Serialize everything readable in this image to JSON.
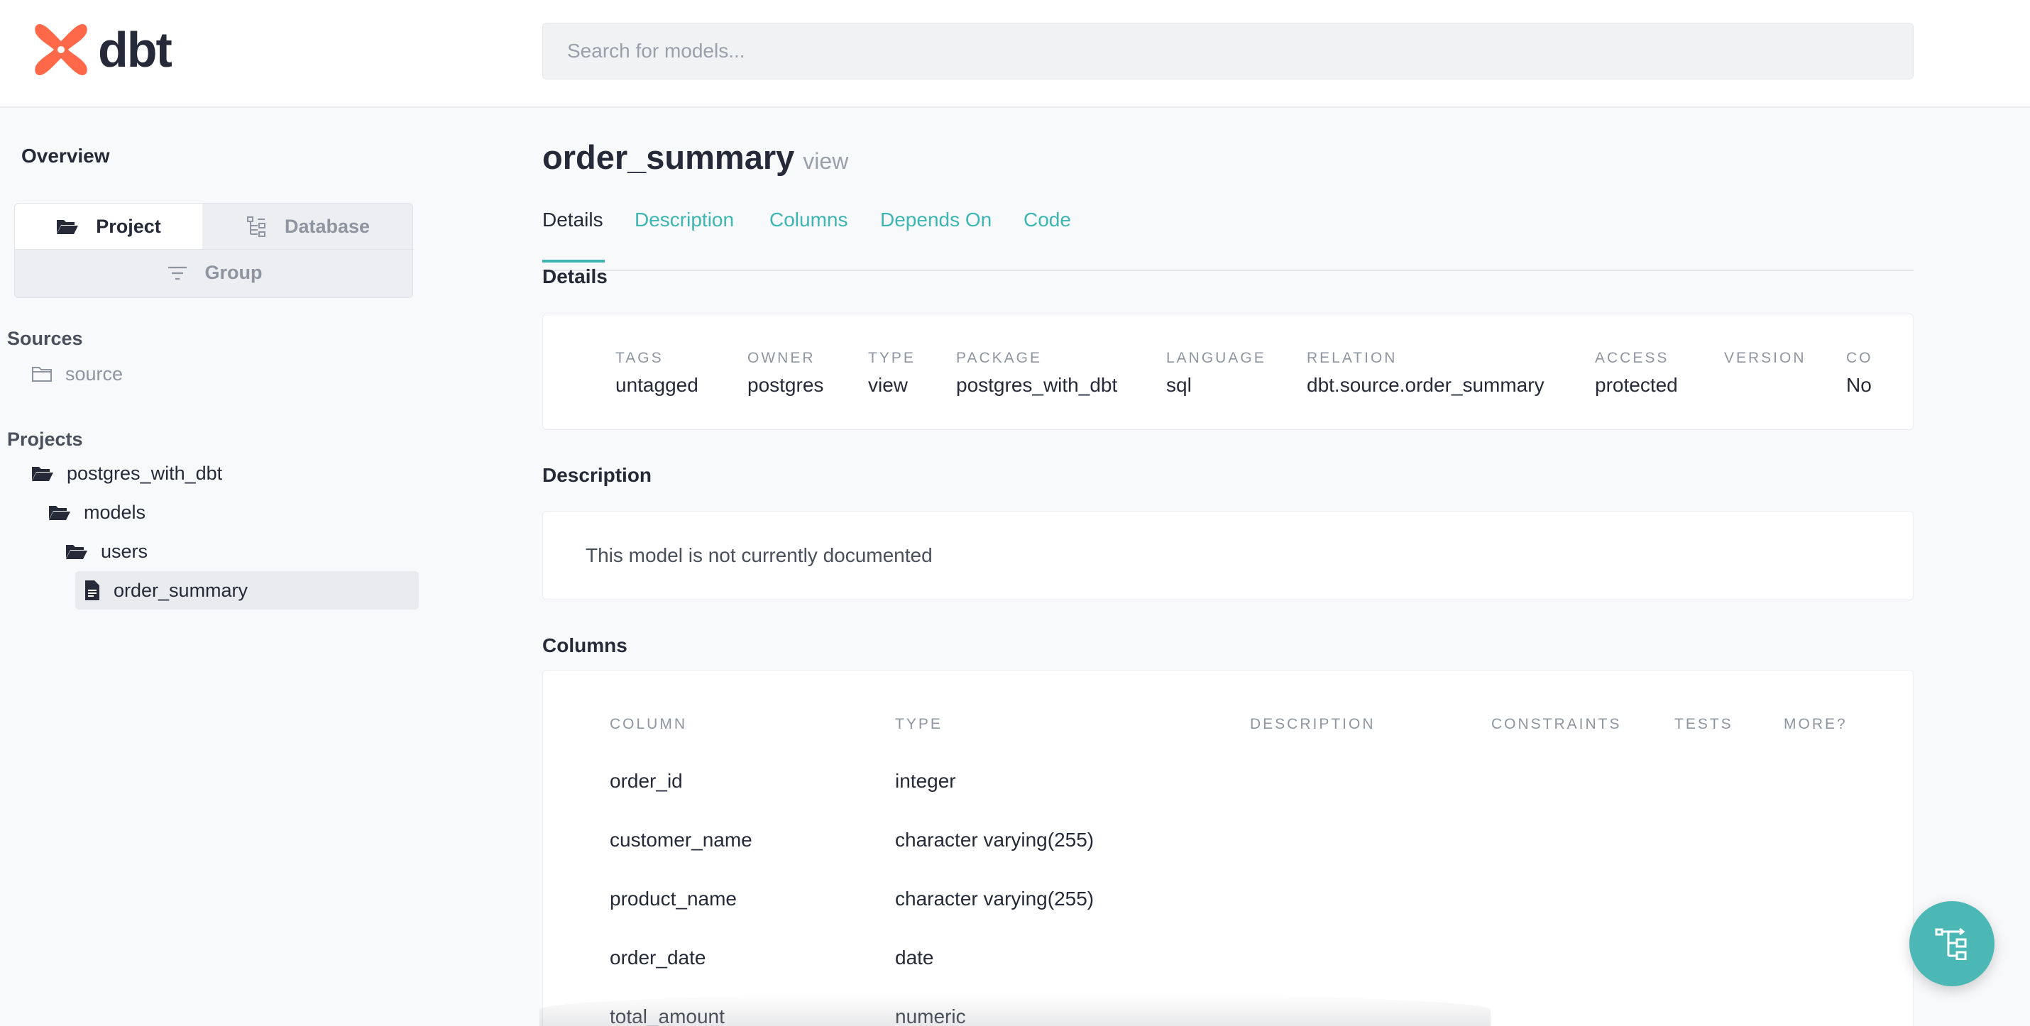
{
  "header": {
    "logo_text": "dbt",
    "search_placeholder": "Search for models...",
    "brand_color": "#ff694a"
  },
  "sidebar": {
    "overview": "Overview",
    "view_tabs": {
      "project": "Project",
      "database": "Database",
      "group": "Group"
    },
    "sources_label": "Sources",
    "sources": [
      {
        "label": "source",
        "icon": "folder-outline-icon"
      }
    ],
    "projects_label": "Projects",
    "tree": [
      {
        "label": "postgres_with_dbt",
        "icon": "folder-open-icon"
      },
      {
        "label": "models",
        "icon": "folder-open-icon"
      },
      {
        "label": "users",
        "icon": "folder-open-icon"
      },
      {
        "label": "order_summary",
        "icon": "file-icon",
        "active": true
      }
    ]
  },
  "main": {
    "title": "order_summary",
    "title_sub": "view",
    "tabs": [
      {
        "label": "Details",
        "active": true
      },
      {
        "label": "Description"
      },
      {
        "label": "Columns"
      },
      {
        "label": "Depends On"
      },
      {
        "label": "Code"
      }
    ],
    "details_heading": "Details",
    "details": {
      "tags_label": "TAGS",
      "tags_value": "untagged",
      "owner_label": "OWNER",
      "owner_value": "postgres",
      "type_label": "TYPE",
      "type_value": "view",
      "package_label": "PACKAGE",
      "package_value": "postgres_with_dbt",
      "language_label": "LANGUAGE",
      "language_value": "sql",
      "relation_label": "RELATION",
      "relation_value": "dbt.source.order_summary",
      "access_label": "ACCESS",
      "access_value": "protected",
      "version_label": "VERSION",
      "version_value": "",
      "contract_label": "CO",
      "contract_value": "No"
    },
    "description_heading": "Description",
    "description_text": "This model is not currently documented",
    "columns_heading": "Columns",
    "columns_table": {
      "headers": [
        "COLUMN",
        "TYPE",
        "DESCRIPTION",
        "CONSTRAINTS",
        "TESTS",
        "MORE?"
      ],
      "rows": [
        {
          "column": "order_id",
          "type": "integer"
        },
        {
          "column": "customer_name",
          "type": "character varying(255)"
        },
        {
          "column": "product_name",
          "type": "character varying(255)"
        },
        {
          "column": "order_date",
          "type": "date"
        },
        {
          "column": "total_amount",
          "type": "numeric"
        }
      ]
    }
  },
  "accent_color": "#3db6b3",
  "fab_icon": "lineage-graph-icon"
}
